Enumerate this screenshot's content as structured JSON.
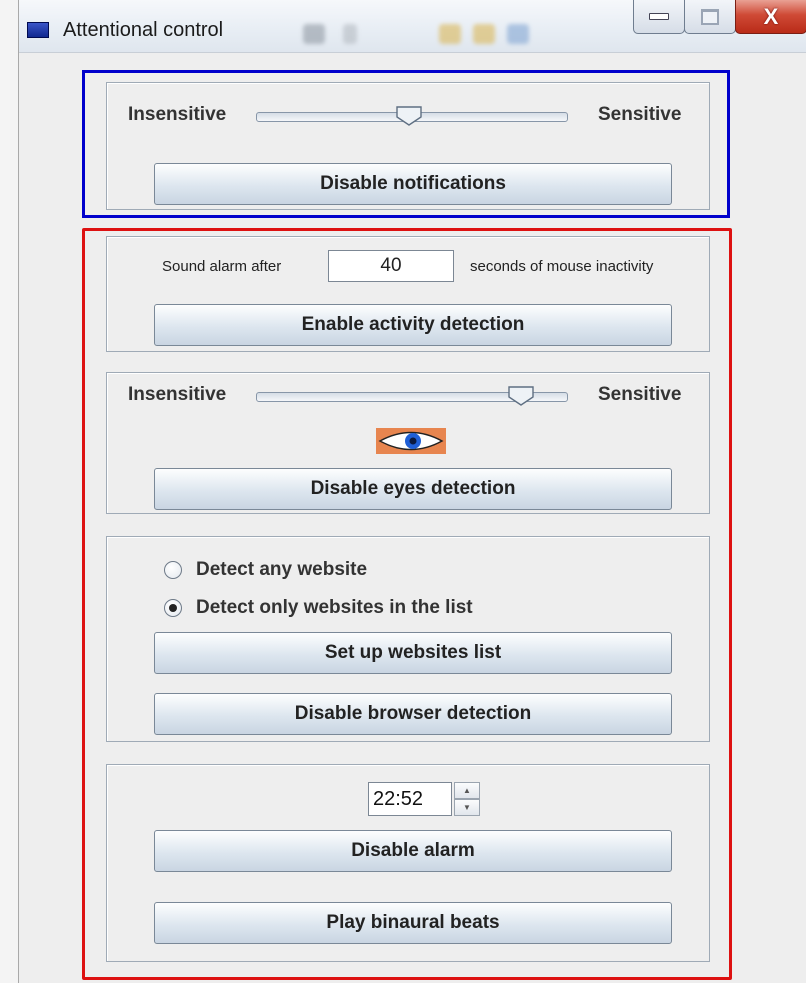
{
  "window": {
    "title": "Attentional control",
    "controls": {
      "close_label": "X"
    }
  },
  "notifications": {
    "slider_min_label": "Insensitive",
    "slider_max_label": "Sensitive",
    "slider_value_fraction": 0.5,
    "button_label": "Disable notifications"
  },
  "activity": {
    "prefix_label": "Sound alarm after",
    "seconds_value": "40",
    "suffix_label": "seconds of mouse inactivity",
    "button_label": "Enable activity detection"
  },
  "eyes": {
    "slider_min_label": "Insensitive",
    "slider_max_label": "Sensitive",
    "slider_value_fraction": 0.85,
    "icon": "eye-icon",
    "button_label": "Disable eyes detection"
  },
  "browser": {
    "radio_any_label": "Detect any website",
    "radio_list_label": "Detect only websites in the list",
    "selected": "list",
    "setup_button_label": "Set up websites list",
    "disable_button_label": "Disable browser detection"
  },
  "alarm": {
    "time_value": "22:52",
    "disable_button_label": "Disable alarm",
    "beats_button_label": "Play binaural beats"
  },
  "colors": {
    "notification_frame": "#0000cc",
    "detection_frame": "#dd1111",
    "close_button": "#cf4a36"
  }
}
